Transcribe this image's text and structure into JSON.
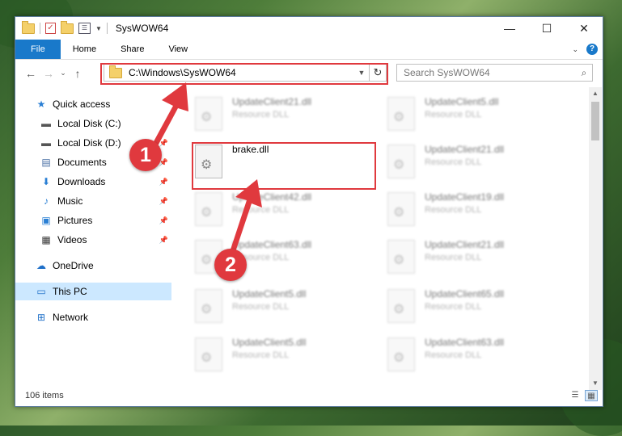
{
  "window": {
    "title": "SysWOW64"
  },
  "ribbon": {
    "tabs": [
      "File",
      "Home",
      "Share",
      "View"
    ]
  },
  "address": {
    "path": "C:\\Windows\\SysWOW64"
  },
  "search": {
    "placeholder": "Search SysWOW64"
  },
  "nav": {
    "items": [
      {
        "label": "Quick access",
        "icon": "star-icon"
      },
      {
        "label": "Local Disk (C:)",
        "icon": "drive-icon"
      },
      {
        "label": "Local Disk (D:)",
        "icon": "drive-icon"
      },
      {
        "label": "Documents",
        "icon": "documents-icon"
      },
      {
        "label": "Downloads",
        "icon": "download-icon"
      },
      {
        "label": "Music",
        "icon": "music-icon"
      },
      {
        "label": "Pictures",
        "icon": "pictures-icon"
      },
      {
        "label": "Videos",
        "icon": "videos-icon"
      },
      {
        "label": "OneDrive",
        "icon": "cloud-icon"
      },
      {
        "label": "This PC",
        "icon": "computer-icon"
      },
      {
        "label": "Network",
        "icon": "network-icon"
      }
    ]
  },
  "files": {
    "left": [
      {
        "name": "UpdateClient21.dll",
        "type": "Resource DLL"
      },
      {
        "name": "brake.dll",
        "type": ""
      },
      {
        "name": "UpdateClient42.dll",
        "type": "Resource DLL"
      },
      {
        "name": "UpdateClient63.dll",
        "type": "Resource DLL"
      },
      {
        "name": "UpdateClient5.dll",
        "type": "Resource DLL"
      },
      {
        "name": "UpdateClient5.dll",
        "type": "Resource DLL"
      }
    ],
    "right": [
      {
        "name": "UpdateClient5.dll",
        "type": "Resource DLL"
      },
      {
        "name": "UpdateClient21.dll",
        "type": "Resource DLL"
      },
      {
        "name": "UpdateClient19.dll",
        "type": "Resource DLL"
      },
      {
        "name": "UpdateClient21.dll",
        "type": "Resource DLL"
      },
      {
        "name": "UpdateClient65.dll",
        "type": "Resource DLL"
      },
      {
        "name": "UpdateClient63.dll",
        "type": "Resource DLL"
      }
    ]
  },
  "status": {
    "count": "106 items"
  },
  "annotations": {
    "step1": "1",
    "step2": "2",
    "color": "#e0393e"
  }
}
